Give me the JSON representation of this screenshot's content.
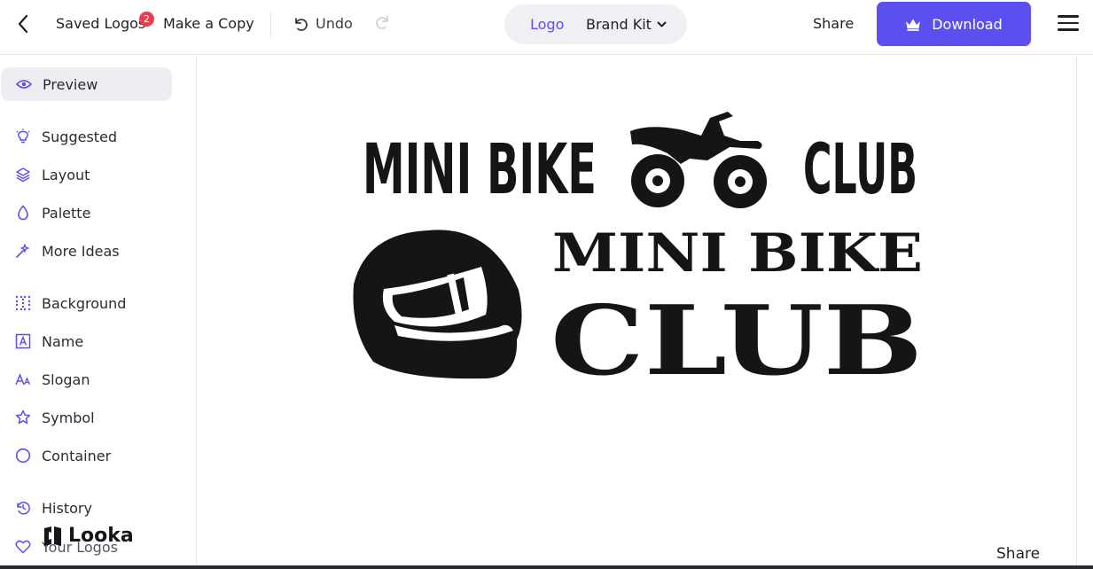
{
  "header": {
    "saved_logos_label": "Saved Logos",
    "saved_logos_count": "2",
    "make_copy_label": "Make a Copy",
    "undo_label": "Undo",
    "toggle": {
      "logo_label": "Logo",
      "brand_kit_label": "Brand Kit"
    },
    "share_label": "Share",
    "download_label": "Download"
  },
  "sidebar": {
    "items": [
      {
        "label": "Preview",
        "icon": "eye-icon"
      },
      {
        "label": "Suggested",
        "icon": "lightbulb-icon"
      },
      {
        "label": "Layout",
        "icon": "layers-icon"
      },
      {
        "label": "Palette",
        "icon": "droplet-icon"
      },
      {
        "label": "More Ideas",
        "icon": "magic-wand-icon"
      },
      {
        "label": "Background",
        "icon": "grid-icon"
      },
      {
        "label": "Name",
        "icon": "text-box-icon"
      },
      {
        "label": "Slogan",
        "icon": "font-size-icon"
      },
      {
        "label": "Symbol",
        "icon": "star-icon"
      },
      {
        "label": "Container",
        "icon": "circle-icon"
      },
      {
        "label": "History",
        "icon": "history-icon"
      },
      {
        "label": "Your Logos",
        "icon": "heart-icon"
      }
    ],
    "brand": "Looka"
  },
  "canvas": {
    "logo1": {
      "left": "MINI BIKE",
      "right": "CLUB"
    },
    "logo2": {
      "line1": "MINI BIKE",
      "line2": "CLUB"
    },
    "share_label": "Share"
  },
  "colors": {
    "accent": "#5b4ff0",
    "badge": "#f03c4f",
    "ink": "#151515"
  }
}
